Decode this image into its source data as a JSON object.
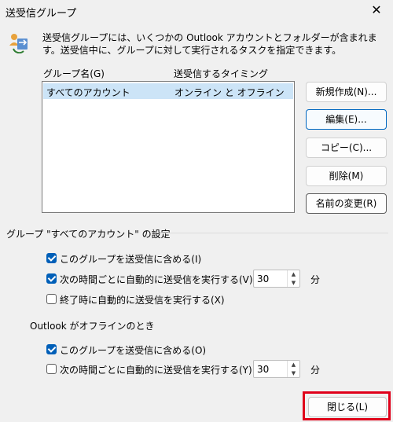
{
  "window": {
    "title": "送受信グループ",
    "close_glyph": "✕"
  },
  "description": "送受信グループには、いくつかの Outlook アカウントとフォルダーが含まれます。送受信中に、グループに対して実行されるタスクを指定できます。",
  "list": {
    "col_group": "グループ名(G)",
    "col_timing": "送受信するタイミング",
    "rows": [
      {
        "name": "すべてのアカウント",
        "timing": "オンライン と オフライン"
      }
    ]
  },
  "buttons": {
    "new": "新規作成(N)...",
    "edit": "編集(E)...",
    "copy": "コピー(C)...",
    "delete": "削除(M)",
    "rename": "名前の変更(R)"
  },
  "group_settings": {
    "label": "グループ \"すべてのアカウント\" の設定",
    "include_online": {
      "label": "このグループを送受信に含める(I)",
      "checked": true
    },
    "auto_online": {
      "label": "次の時間ごとに自動的に送受信を実行する(V)",
      "checked": true,
      "value": "30",
      "unit": "分"
    },
    "on_exit": {
      "label": "終了時に自動的に送受信を実行する(X)",
      "checked": false
    }
  },
  "offline": {
    "label": "Outlook がオフラインのとき",
    "include": {
      "label": "このグループを送受信に含める(O)",
      "checked": true
    },
    "auto": {
      "label": "次の時間ごとに自動的に送受信を実行する(Y)",
      "checked": false,
      "value": "30",
      "unit": "分"
    }
  },
  "close_button": "閉じる(L)",
  "colors": {
    "accent": "#005fb8",
    "selection": "#cce4f7",
    "highlight": "#e0001a"
  },
  "icons": {
    "app": "send-receive-groups-icon",
    "spin_up": "chevron-up-icon",
    "spin_down": "chevron-down-icon"
  }
}
